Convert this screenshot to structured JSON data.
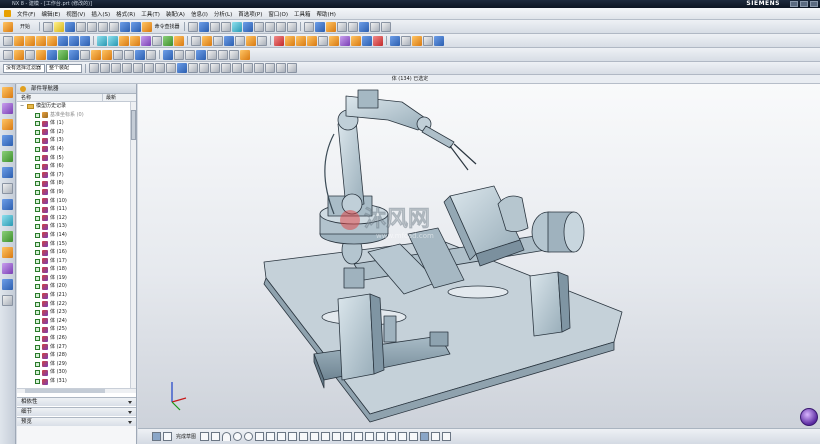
{
  "window": {
    "title": "NX 8 - 建模 - [工作台.prt (修改的)]",
    "brand": "SIEMENS"
  },
  "menu": {
    "items": [
      "文件(F)",
      "编辑(E)",
      "视图(V)",
      "插入(S)",
      "格式(R)",
      "工具(T)",
      "装配(A)",
      "信息(I)",
      "分析(L)",
      "首选项(P)",
      "窗口(O)",
      "工具箱",
      "帮助(H)"
    ]
  },
  "toolbar": {
    "start_label": "开始",
    "command_finder": "命令查找器",
    "selection_filter": "没有选择过滤器",
    "selection_scope": "整个装配"
  },
  "status": {
    "text": "体 (134) 已选定"
  },
  "navigator": {
    "title": "部件导航器",
    "col_name": "名称",
    "col_latest": "最新",
    "root_label": "模型历史记录",
    "coord_label": "基准坐标系 (0)",
    "bodies": [
      "体 (1)",
      "体 (2)",
      "体 (3)",
      "体 (4)",
      "体 (5)",
      "体 (6)",
      "体 (7)",
      "体 (8)",
      "体 (9)",
      "体 (10)",
      "体 (11)",
      "体 (12)",
      "体 (13)",
      "体 (14)",
      "体 (15)",
      "体 (16)",
      "体 (17)",
      "体 (18)",
      "体 (19)",
      "体 (20)",
      "体 (21)",
      "体 (22)",
      "体 (23)",
      "体 (24)",
      "体 (25)",
      "体 (26)",
      "体 (27)",
      "体 (28)",
      "体 (29)",
      "体 (30)",
      "体 (31)"
    ],
    "panels": [
      "相依性",
      "细节",
      "预览"
    ]
  },
  "watermark": {
    "text": "沐风网",
    "url": "www.mfcad.com"
  },
  "bottom": {
    "curve_label": "完成草图"
  },
  "colors": {
    "model_fill": "#b8c8d2",
    "model_edge": "#2b3640",
    "title_bar": "#0c1522",
    "viewport_bg": "#e6e9ee"
  }
}
